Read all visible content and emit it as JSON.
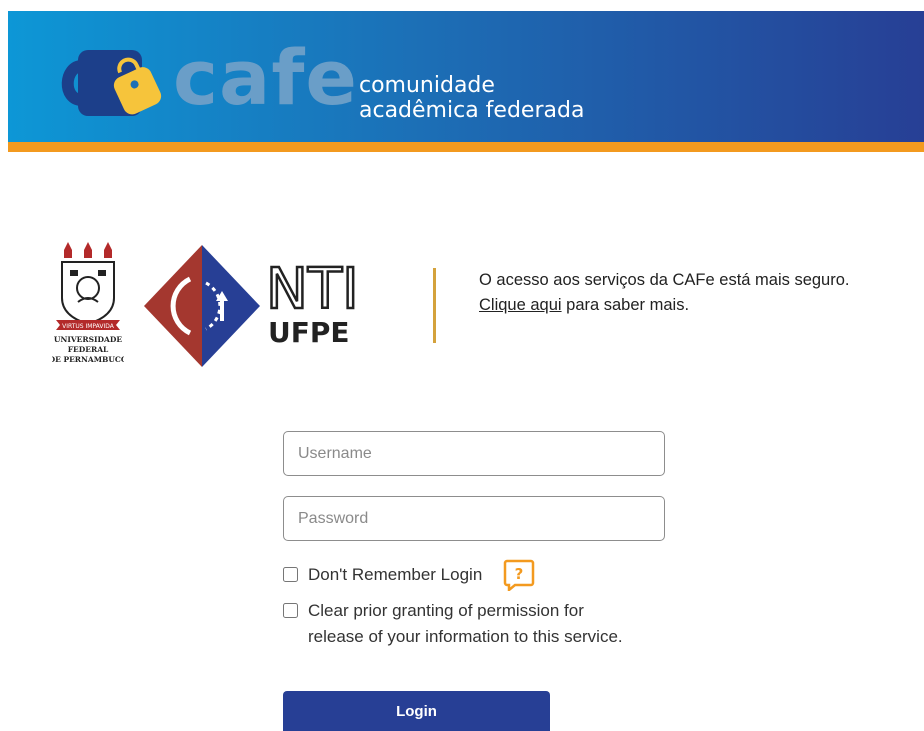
{
  "header": {
    "logo_word": "cafe",
    "tagline_line1": "comunidade",
    "tagline_line2": "acadêmica federada",
    "colors": {
      "accent_stripe": "#f39a1f",
      "gradient_start": "#0d97d6",
      "gradient_end": "#273f95"
    }
  },
  "institution": {
    "crest_motto": "VIRTUS IMPAVIDA",
    "crest_name_line1": "UNIVERSIDADE",
    "crest_name_line2": "FEDERAL",
    "crest_name_line3": "DE PERNAMBUCO",
    "nti_top": "NTI",
    "nti_bottom": "UFPE"
  },
  "notice": {
    "text": "O acesso aos serviços da CAFe está mais seguro.",
    "link_text": "Clique aqui",
    "after_link": " para saber mais."
  },
  "form": {
    "username_placeholder": "Username",
    "password_placeholder": "Password",
    "dont_remember_label": "Don't Remember Login",
    "help_icon": "question-mark-icon",
    "help_symbol": "?",
    "clear_permission_line1": "Clear prior granting of permission for",
    "clear_permission_line2": "release of your information to this service.",
    "login_label": "Login"
  }
}
